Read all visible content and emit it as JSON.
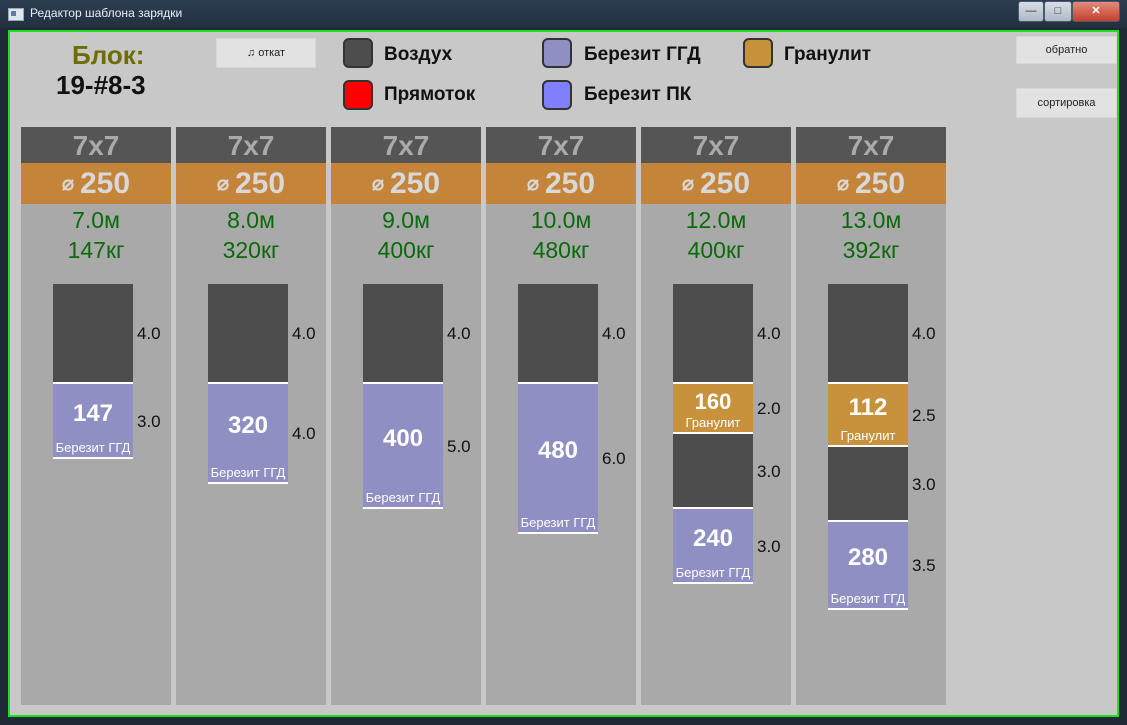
{
  "window": {
    "title": "Редактор шаблона зарядки"
  },
  "header": {
    "block_label": "Блок:",
    "block_id": "19-#8-3",
    "undo_label": "♫ откат"
  },
  "side_buttons": {
    "back": "обратно",
    "sort": "сортировка"
  },
  "legend": [
    {
      "label": "Воздух",
      "color": "#4d4d4d"
    },
    {
      "label": "Прямоток",
      "color": "#ff0000"
    },
    {
      "label": "Березит ГГД",
      "color": "#8f8fc3"
    },
    {
      "label": "Березит ПК",
      "color": "#8080ff"
    },
    {
      "label": "Гранулит",
      "color": "#c8923c"
    }
  ],
  "colors": {
    "accent_border": "#1ee01e",
    "depth_text": "#0a6a0a"
  },
  "holes": [
    {
      "size": "7x7",
      "diameter": "250",
      "depth": "7.0м",
      "mass": "147кг",
      "layers": [
        {
          "type": "air",
          "length": "4.0"
        },
        {
          "type": "ggd",
          "length": "3.0",
          "amount": "147",
          "name": "Березит ГГД"
        }
      ]
    },
    {
      "size": "7x7",
      "diameter": "250",
      "depth": "8.0м",
      "mass": "320кг",
      "layers": [
        {
          "type": "air",
          "length": "4.0"
        },
        {
          "type": "ggd",
          "length": "4.0",
          "amount": "320",
          "name": "Березит ГГД"
        }
      ]
    },
    {
      "size": "7x7",
      "diameter": "250",
      "depth": "9.0м",
      "mass": "400кг",
      "layers": [
        {
          "type": "air",
          "length": "4.0"
        },
        {
          "type": "ggd",
          "length": "5.0",
          "amount": "400",
          "name": "Березит ГГД"
        }
      ]
    },
    {
      "size": "7x7",
      "diameter": "250",
      "depth": "10.0м",
      "mass": "480кг",
      "layers": [
        {
          "type": "air",
          "length": "4.0"
        },
        {
          "type": "ggd",
          "length": "6.0",
          "amount": "480",
          "name": "Березит ГГД"
        }
      ]
    },
    {
      "size": "7x7",
      "diameter": "250",
      "depth": "12.0м",
      "mass": "400кг",
      "layers": [
        {
          "type": "air",
          "length": "4.0"
        },
        {
          "type": "gran",
          "length": "2.0",
          "amount": "160",
          "name": "Гранулит"
        },
        {
          "type": "air",
          "length": "3.0"
        },
        {
          "type": "ggd",
          "length": "3.0",
          "amount": "240",
          "name": "Березит ГГД"
        }
      ]
    },
    {
      "size": "7x7",
      "diameter": "250",
      "depth": "13.0м",
      "mass": "392кг",
      "layers": [
        {
          "type": "air",
          "length": "4.0"
        },
        {
          "type": "gran",
          "length": "2.5",
          "amount": "112",
          "name": "Гранулит"
        },
        {
          "type": "air",
          "length": "3.0"
        },
        {
          "type": "ggd",
          "length": "3.5",
          "amount": "280",
          "name": "Березит ГГД"
        }
      ]
    }
  ]
}
